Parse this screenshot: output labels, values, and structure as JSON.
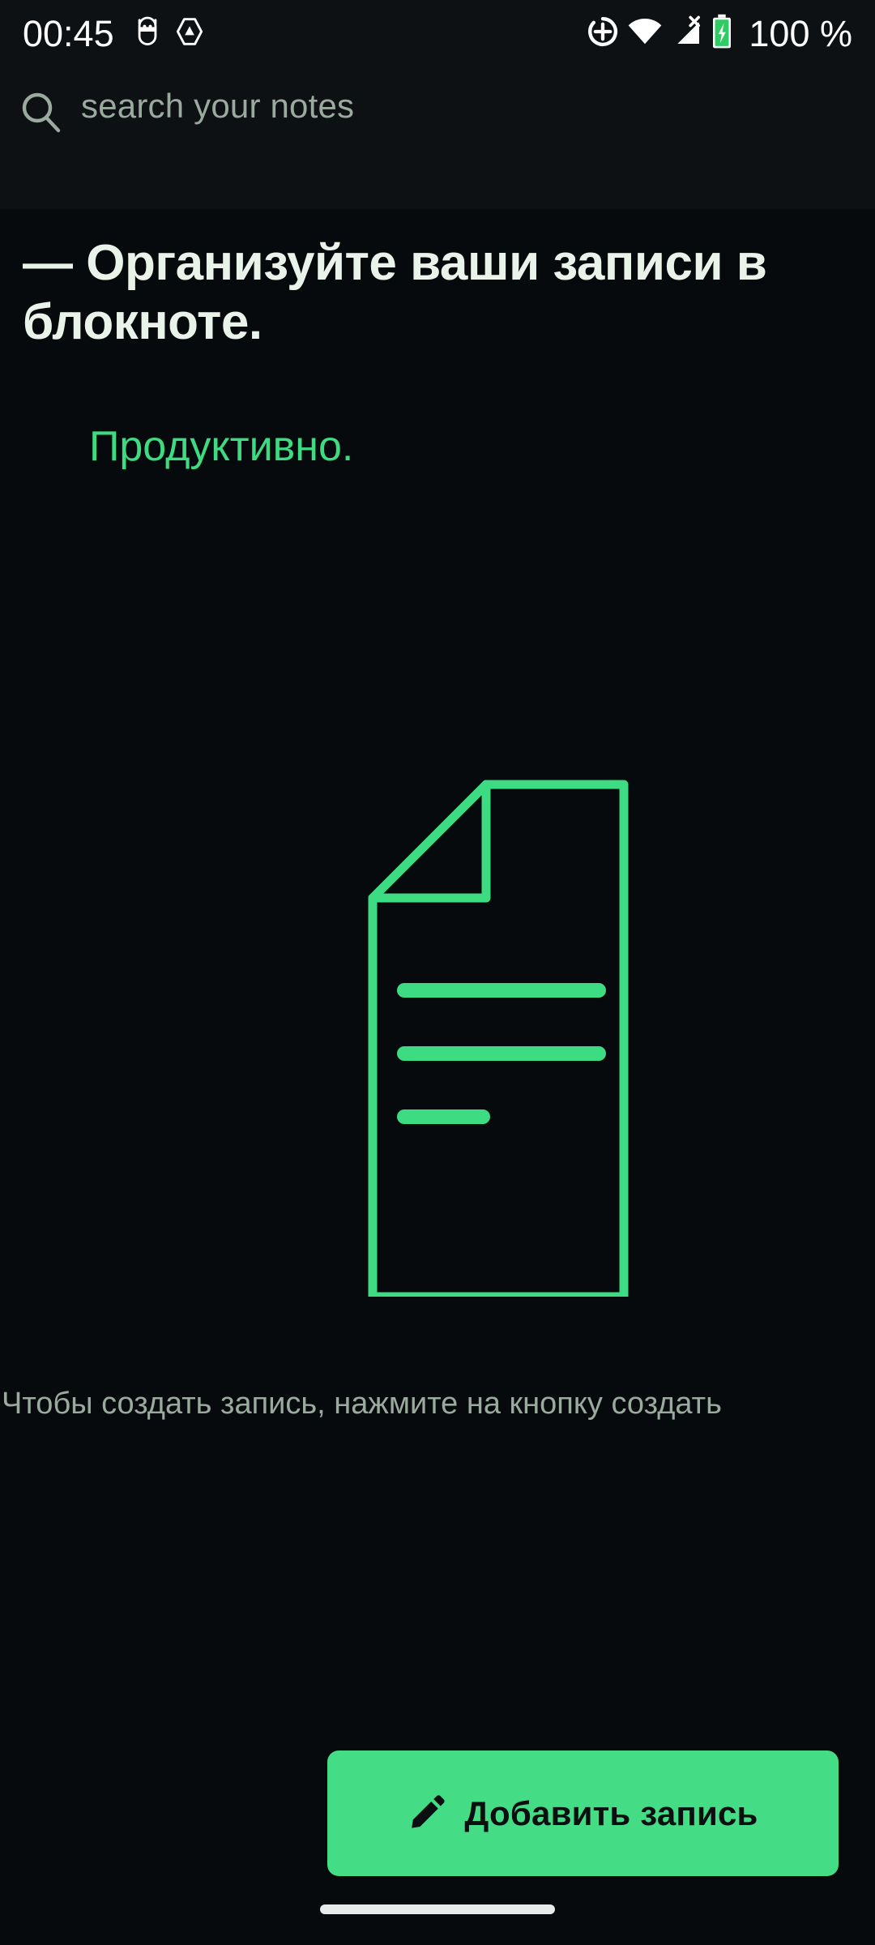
{
  "status_bar": {
    "clock": "00:45",
    "battery_text": "100 %",
    "left_icons": [
      "app-notification-icon",
      "app-triangle-icon"
    ],
    "right_icons": [
      "location-add-icon",
      "wifi-icon",
      "cellular-no-sim-icon",
      "battery-charging-icon"
    ]
  },
  "search": {
    "placeholder": "search your notes",
    "value": "",
    "icon": "search-icon"
  },
  "headline": {
    "text": "— Организуйте ваши записи в блокноте.",
    "accent_text": "Продуктивно."
  },
  "empty_state": {
    "illustration": "document-with-folded-corner-icon",
    "hint": "Чтобы создать запись, нажмите на кнопку создать"
  },
  "add_button": {
    "label": "Добавить запись",
    "icon": "pencil-icon"
  },
  "navigation": {
    "gesture_pill": "home-gesture-pill"
  },
  "colors": {
    "background": "#070a0c",
    "surface": "#0d1114",
    "accent_green": "#3ddb82",
    "button_green": "#44dc85",
    "text_primary": "#eaf3ea",
    "text_muted": "#9aaa9e",
    "button_text": "#0b0f11"
  }
}
